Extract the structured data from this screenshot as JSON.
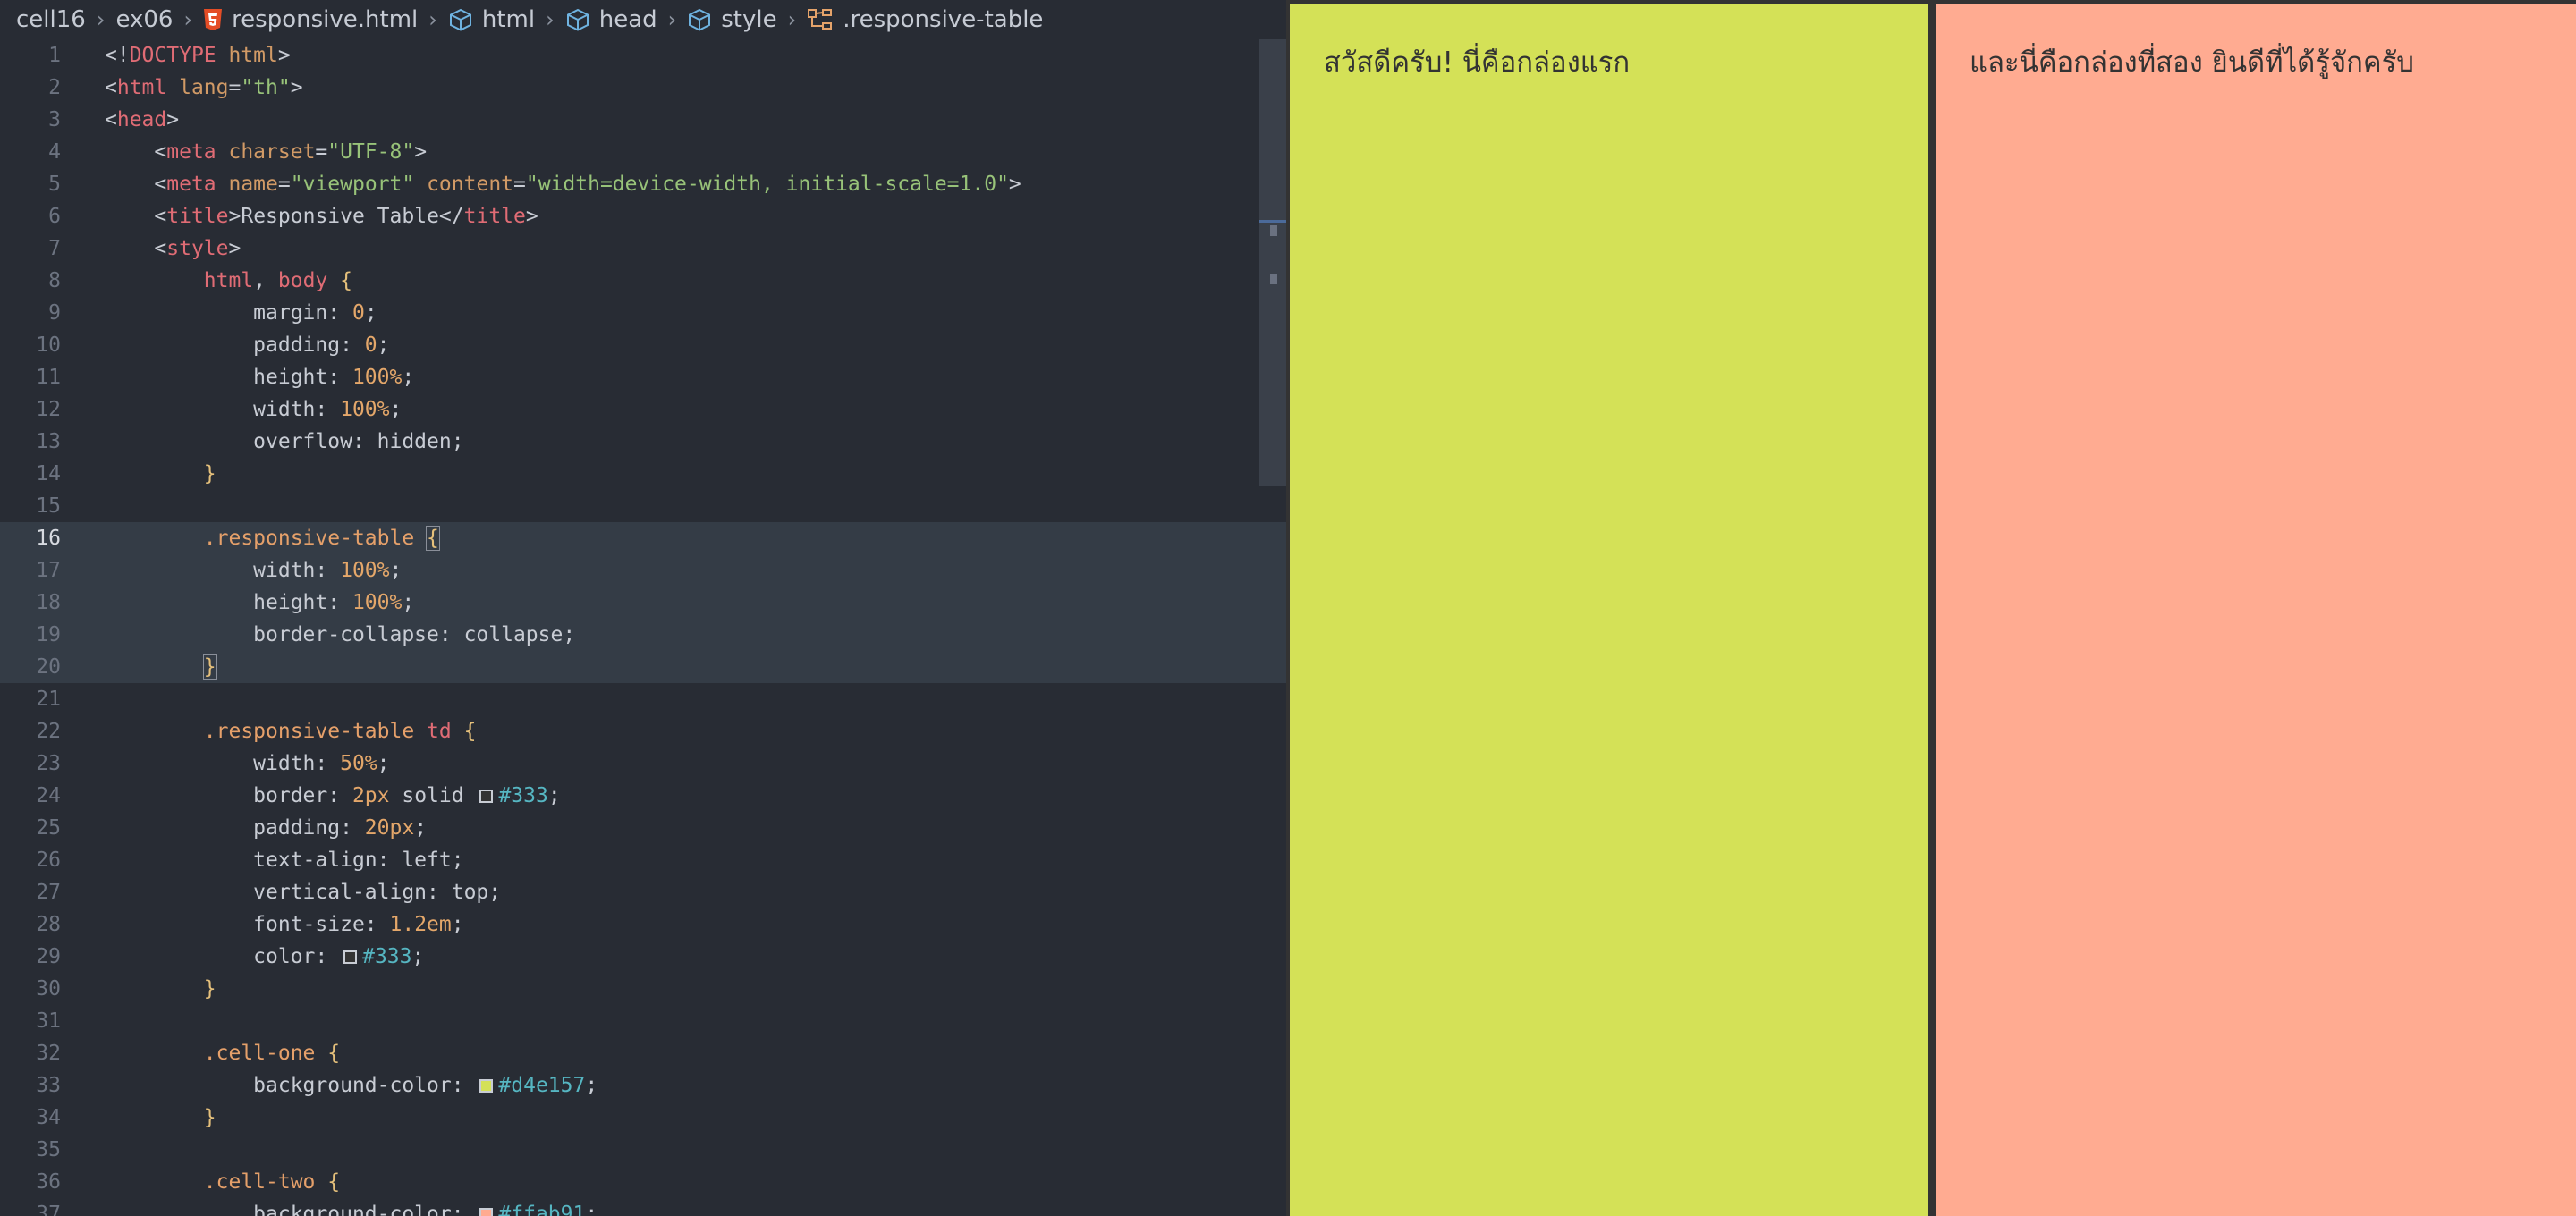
{
  "breadcrumb": {
    "items": [
      {
        "label": "cell16"
      },
      {
        "label": "ex06"
      },
      {
        "label": "responsive.html",
        "icon": "html5-file-icon"
      },
      {
        "label": "html",
        "icon": "cube-icon"
      },
      {
        "label": "head",
        "icon": "cube-icon"
      },
      {
        "label": "style",
        "icon": "cube-icon"
      },
      {
        "label": ".responsive-table",
        "icon": "css-selector-icon"
      }
    ]
  },
  "editor": {
    "active_line": "16",
    "lines": [
      {
        "n": "1",
        "t": [
          [
            "<!",
            "p"
          ],
          [
            "DOCTYPE",
            "tag"
          ],
          [
            " html",
            "attr"
          ],
          [
            ">",
            "p"
          ]
        ]
      },
      {
        "n": "2",
        "t": [
          [
            "<",
            "p"
          ],
          [
            "html",
            "tag"
          ],
          [
            " lang",
            "attr"
          ],
          [
            "=",
            "p"
          ],
          [
            "\"th\"",
            "str"
          ],
          [
            ">",
            "p"
          ]
        ]
      },
      {
        "n": "3",
        "t": [
          [
            "<",
            "p"
          ],
          [
            "head",
            "tag"
          ],
          [
            ">",
            "p"
          ]
        ]
      },
      {
        "n": "4",
        "t": [
          [
            "    <",
            "p"
          ],
          [
            "meta",
            "tag"
          ],
          [
            " charset",
            "attr"
          ],
          [
            "=",
            "p"
          ],
          [
            "\"UTF-8\"",
            "str"
          ],
          [
            ">",
            "p"
          ]
        ]
      },
      {
        "n": "5",
        "t": [
          [
            "    <",
            "p"
          ],
          [
            "meta",
            "tag"
          ],
          [
            " name",
            "attr"
          ],
          [
            "=",
            "p"
          ],
          [
            "\"viewport\"",
            "str"
          ],
          [
            " content",
            "attr"
          ],
          [
            "=",
            "p"
          ],
          [
            "\"width=device-width, initial-scale=1.0\"",
            "str"
          ],
          [
            ">",
            "p"
          ]
        ]
      },
      {
        "n": "6",
        "t": [
          [
            "    <",
            "p"
          ],
          [
            "title",
            "tag"
          ],
          [
            ">",
            "p"
          ],
          [
            "Responsive Table",
            "kw"
          ],
          [
            "</",
            "p"
          ],
          [
            "title",
            "tag"
          ],
          [
            ">",
            "p"
          ]
        ]
      },
      {
        "n": "7",
        "t": [
          [
            "    <",
            "p"
          ],
          [
            "style",
            "tag"
          ],
          [
            ">",
            "p"
          ]
        ]
      },
      {
        "n": "8",
        "t": [
          [
            "        ",
            "p"
          ],
          [
            "html",
            "tag"
          ],
          [
            ", ",
            "p"
          ],
          [
            "body",
            "tag"
          ],
          [
            " ",
            "p"
          ],
          [
            "{",
            "brace"
          ]
        ]
      },
      {
        "n": "9",
        "t": [
          [
            "            margin: ",
            "kw"
          ],
          [
            "0",
            "num"
          ],
          [
            ";",
            "p"
          ]
        ]
      },
      {
        "n": "10",
        "t": [
          [
            "            padding: ",
            "kw"
          ],
          [
            "0",
            "num"
          ],
          [
            ";",
            "p"
          ]
        ]
      },
      {
        "n": "11",
        "t": [
          [
            "            height: ",
            "kw"
          ],
          [
            "100%",
            "num"
          ],
          [
            ";",
            "p"
          ]
        ]
      },
      {
        "n": "12",
        "t": [
          [
            "            width: ",
            "kw"
          ],
          [
            "100%",
            "num"
          ],
          [
            ";",
            "p"
          ]
        ]
      },
      {
        "n": "13",
        "t": [
          [
            "            overflow: hidden;",
            "kw"
          ]
        ]
      },
      {
        "n": "14",
        "t": [
          [
            "        ",
            "p"
          ],
          [
            "}",
            "brace"
          ]
        ]
      },
      {
        "n": "15",
        "t": []
      },
      {
        "n": "16",
        "t": [
          [
            "        ",
            "p"
          ],
          [
            ".responsive-table",
            "sel"
          ],
          [
            " ",
            "p"
          ],
          [
            "{",
            "brace"
          ]
        ]
      },
      {
        "n": "17",
        "t": [
          [
            "            width: ",
            "kw"
          ],
          [
            "100%",
            "num"
          ],
          [
            ";",
            "p"
          ]
        ]
      },
      {
        "n": "18",
        "t": [
          [
            "            height: ",
            "kw"
          ],
          [
            "100%",
            "num"
          ],
          [
            ";",
            "p"
          ]
        ]
      },
      {
        "n": "19",
        "t": [
          [
            "            border-collapse: collapse;",
            "kw"
          ]
        ]
      },
      {
        "n": "20",
        "t": [
          [
            "        ",
            "p"
          ],
          [
            "}",
            "brace"
          ]
        ]
      },
      {
        "n": "21",
        "t": []
      },
      {
        "n": "22",
        "t": [
          [
            "        ",
            "p"
          ],
          [
            ".responsive-table",
            "sel"
          ],
          [
            " ",
            "p"
          ],
          [
            "td",
            "tag"
          ],
          [
            " ",
            "p"
          ],
          [
            "{",
            "brace"
          ]
        ]
      },
      {
        "n": "23",
        "t": [
          [
            "            width: ",
            "kw"
          ],
          [
            "50%",
            "num"
          ],
          [
            ";",
            "p"
          ]
        ]
      },
      {
        "n": "24",
        "t": [
          [
            "            border: ",
            "kw"
          ],
          [
            "2px",
            "num"
          ],
          [
            " solid ",
            "kw"
          ],
          [
            "#333",
            "swatch"
          ],
          [
            "#333",
            "hex"
          ],
          [
            ";",
            "p"
          ]
        ]
      },
      {
        "n": "25",
        "t": [
          [
            "            padding: ",
            "kw"
          ],
          [
            "20px",
            "num"
          ],
          [
            ";",
            "p"
          ]
        ]
      },
      {
        "n": "26",
        "t": [
          [
            "            text-align: left;",
            "kw"
          ]
        ]
      },
      {
        "n": "27",
        "t": [
          [
            "            vertical-align: top;",
            "kw"
          ]
        ]
      },
      {
        "n": "28",
        "t": [
          [
            "            font-size: ",
            "kw"
          ],
          [
            "1.2em",
            "num"
          ],
          [
            ";",
            "p"
          ]
        ]
      },
      {
        "n": "29",
        "t": [
          [
            "            color: ",
            "kw"
          ],
          [
            "#333",
            "swatch"
          ],
          [
            "#333",
            "hex"
          ],
          [
            ";",
            "p"
          ]
        ]
      },
      {
        "n": "30",
        "t": [
          [
            "        ",
            "p"
          ],
          [
            "}",
            "brace"
          ]
        ]
      },
      {
        "n": "31",
        "t": []
      },
      {
        "n": "32",
        "t": [
          [
            "        ",
            "p"
          ],
          [
            ".cell-one",
            "sel"
          ],
          [
            " ",
            "p"
          ],
          [
            "{",
            "brace"
          ]
        ]
      },
      {
        "n": "33",
        "t": [
          [
            "            background-color: ",
            "kw"
          ],
          [
            "#d4e157",
            "swatch"
          ],
          [
            "#d4e157",
            "hex"
          ],
          [
            ";",
            "p"
          ]
        ]
      },
      {
        "n": "34",
        "t": [
          [
            "        ",
            "p"
          ],
          [
            "}",
            "brace"
          ]
        ]
      },
      {
        "n": "35",
        "t": []
      },
      {
        "n": "36",
        "t": [
          [
            "        ",
            "p"
          ],
          [
            ".cell-two",
            "sel"
          ],
          [
            " ",
            "p"
          ],
          [
            "{",
            "brace"
          ]
        ]
      },
      {
        "n": "37",
        "t": [
          [
            "            background-color: ",
            "kw"
          ],
          [
            "#ffab91",
            "swatch"
          ],
          [
            "#ffab91",
            "hex"
          ],
          [
            ";",
            "p"
          ]
        ]
      }
    ]
  },
  "preview": {
    "cell_one_text": "สวัสดีครับ! นี่คือกล่องแรก",
    "cell_two_text": "และนี่คือกล่องที่สอง ยินดีที่ได้รู้จักครับ",
    "cell_one_color": "#d4e157",
    "cell_two_color": "#ffab91",
    "border_color": "#333"
  }
}
